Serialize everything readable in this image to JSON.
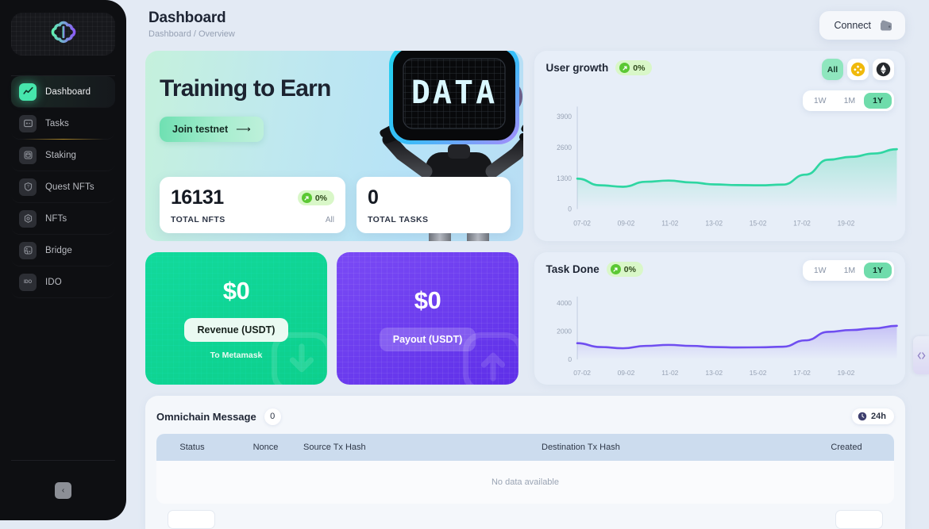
{
  "sidebar": {
    "logo_name": "brain-logo",
    "items": [
      {
        "label": "Dashboard",
        "icon": "chart-line-icon",
        "active": true
      },
      {
        "label": "Tasks",
        "icon": "checklist-icon",
        "active": false
      },
      {
        "label": "Staking",
        "icon": "database-icon",
        "active": false
      },
      {
        "label": "Quest NFTs",
        "icon": "shield-question-icon",
        "active": false
      },
      {
        "label": "NFTs",
        "icon": "hexagon-icon",
        "active": false
      },
      {
        "label": "Bridge",
        "icon": "bridge-grid-icon",
        "active": false
      },
      {
        "label": "IDO",
        "icon": "ido-badge-icon",
        "active": false
      }
    ],
    "collapse_label": "‹"
  },
  "header": {
    "title": "Dashboard",
    "breadcrumb": "Dashboard / Overview",
    "connect_label": "Connect"
  },
  "hero": {
    "title": "Training to Earn",
    "cta_label": "Join testnet",
    "cta_arrow": "⟶",
    "robot_screen_text": "DATA",
    "stats": [
      {
        "value": "16131",
        "label": "TOTAL NFTS",
        "badge": "0%",
        "sub": "All"
      },
      {
        "value": "0",
        "label": "TOTAL TASKS",
        "badge": "",
        "sub": ""
      }
    ]
  },
  "money": [
    {
      "amount": "$0",
      "button": "Revenue (USDT)",
      "sub": "To Metamask",
      "color": "#2bb489",
      "icon": "download-arrow-icon"
    },
    {
      "amount": "$0",
      "button": "Payout (USDT)",
      "sub": "",
      "color": "#6a3df0",
      "icon": "upload-arrow-icon"
    }
  ],
  "chart_data": [
    {
      "type": "area",
      "title": "User growth",
      "badge": "0%",
      "xlabel": "",
      "ylabel": "",
      "ylim": [
        0,
        3900
      ],
      "yticks": [
        "0",
        "1300",
        "2600",
        "3900"
      ],
      "categories": [
        "07-02",
        "09-02",
        "11-02",
        "13-02",
        "15-02",
        "17-02",
        "19-02"
      ],
      "xticks": [
        "07-02",
        "09-02",
        "11-02",
        "13-02",
        "15-02",
        "17-02",
        "19-02"
      ],
      "x": [
        0,
        1,
        2,
        3,
        4,
        5,
        6,
        7,
        8,
        9,
        10,
        11,
        12,
        13
      ],
      "values": [
        1280,
        1000,
        940,
        1150,
        1200,
        1120,
        1040,
        1010,
        1000,
        1030,
        1450,
        2080,
        2200,
        2340,
        2520
      ],
      "color": "#2fd6a2",
      "grid": false,
      "legend": "none",
      "ranges": [
        "1W",
        "1M",
        "1Y"
      ],
      "selected_range": "1Y",
      "chains": [
        "All",
        "bnb-icon",
        "ethereum-icon"
      ],
      "selected_chain": "All"
    },
    {
      "type": "area",
      "title": "Task Done",
      "badge": "0%",
      "xlabel": "",
      "ylabel": "",
      "ylim": [
        0,
        4000
      ],
      "yticks": [
        "0",
        "2000",
        "4000"
      ],
      "categories": [
        "07-02",
        "09-02",
        "11-02",
        "13-02",
        "15-02",
        "17-02",
        "19-02"
      ],
      "xticks": [
        "07-02",
        "09-02",
        "11-02",
        "13-02",
        "15-02",
        "17-02",
        "19-02"
      ],
      "x": [
        0,
        1,
        2,
        3,
        4,
        5,
        6,
        7,
        8,
        9,
        10,
        11,
        12,
        13
      ],
      "values": [
        1150,
        880,
        790,
        960,
        1030,
        960,
        880,
        850,
        860,
        900,
        1350,
        1950,
        2080,
        2200,
        2380
      ],
      "color": "#6f4ef0",
      "grid": false,
      "legend": "none",
      "ranges": [
        "1W",
        "1M",
        "1Y"
      ],
      "selected_range": "1Y"
    }
  ],
  "table": {
    "title": "Omnichain Message",
    "count": "0",
    "time_badge": "24h",
    "columns": [
      "Status",
      "Nonce",
      "Source Tx Hash",
      "Destination Tx Hash",
      "Created"
    ],
    "empty_text": "No data available",
    "rows": []
  },
  "edge_tab": {
    "icon": "expand-panel-icon"
  }
}
